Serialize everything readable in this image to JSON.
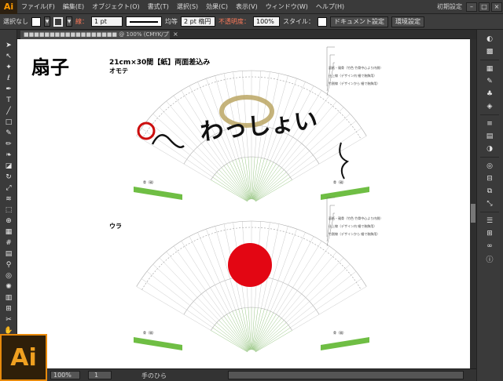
{
  "menubar": {
    "logo": "Ai",
    "items": [
      "ファイル(F)",
      "編集(E)",
      "オブジェクト(O)",
      "書式(T)",
      "選択(S)",
      "効果(C)",
      "表示(V)",
      "ウィンドウ(W)",
      "ヘルプ(H)"
    ],
    "preset": "初期設定",
    "window_buttons": [
      "–",
      "□",
      "×"
    ]
  },
  "controlbar": {
    "selection": "選択なし",
    "stroke_label": "線：",
    "stroke_weight": "1 pt",
    "line_style": "均等",
    "brush": "2 pt 楕円",
    "opacity_label": "不透明度：",
    "opacity_value": "100%",
    "style_label": "スタイル：",
    "doc_settings": "ドキュメント設定",
    "prefs": "環境設定"
  },
  "tab": {
    "title": "■■■■■■■■■■■■■■■■■■ @ 100% (CMYK/プレビュー)",
    "close": "×"
  },
  "tools": [
    "selection-arrow",
    "direct-select-arrow",
    "magic-wand",
    "lasso",
    "pen",
    "type",
    "line",
    "rectangle",
    "paintbrush",
    "pencil",
    "blob-brush",
    "eraser",
    "rotate",
    "scale",
    "warp",
    "free-transform",
    "shape-builder",
    "perspective-grid",
    "mesh",
    "gradient",
    "eyedropper",
    "blend",
    "symbol-sprayer",
    "column-graph",
    "artboard",
    "slice",
    "hand",
    "zoom"
  ],
  "artwork": {
    "title": "扇子",
    "spec": "21cm×30間【紙】両面差込み",
    "front_label": "オモテ",
    "back_label": "ウラ",
    "front_text": "わっしょい",
    "front_notes": [
      "面紙・親骨（竹色 竹骨中心より内側）",
      "仕上線（デザイン内 細で装飾用）",
      "竹割線（デザインから 細で装飾用）"
    ],
    "back_notes": [
      "面紙・親骨（竹色 竹骨中心より内側）",
      "仕上線（デザイン内 細で装飾用）",
      "竹割線（デザインから 細で装飾用）"
    ],
    "rib_label": "骨（親）",
    "sun_color": "#e30613",
    "rib_color": "#6fbe44",
    "guide_color": "#7bb661"
  },
  "status": {
    "zoom": "100%",
    "page": "1",
    "tool": "手のひら"
  },
  "colors": {
    "ai_orange": "#ff9a00",
    "ui_dark": "#3a3a3a",
    "highlight": "#ff7a5a"
  }
}
